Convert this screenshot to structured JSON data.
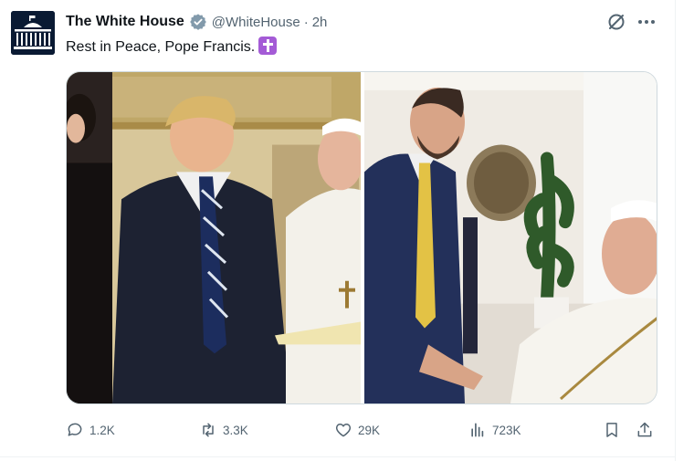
{
  "tweet": {
    "author": {
      "display_name": "The White House",
      "handle": "@WhiteHouse",
      "verified": true,
      "avatar_icon": "white-house-logo-icon"
    },
    "separator": "·",
    "time": "2h",
    "text": "Rest in Peace, Pope Francis.",
    "emoji": "latin-cross-emoji",
    "images": [
      {
        "name": "photo-pope-meeting-1"
      },
      {
        "name": "photo-pope-meeting-2"
      }
    ]
  },
  "actions": {
    "reply_count": "1.2K",
    "retweet_count": "3.3K",
    "like_count": "29K",
    "view_count": "723K"
  },
  "colors": {
    "text_primary": "#0f1419",
    "text_secondary": "#536471",
    "verified_badge": "#829aab",
    "emoji_purple": "#a45bd6",
    "border": "#cfd9de"
  }
}
